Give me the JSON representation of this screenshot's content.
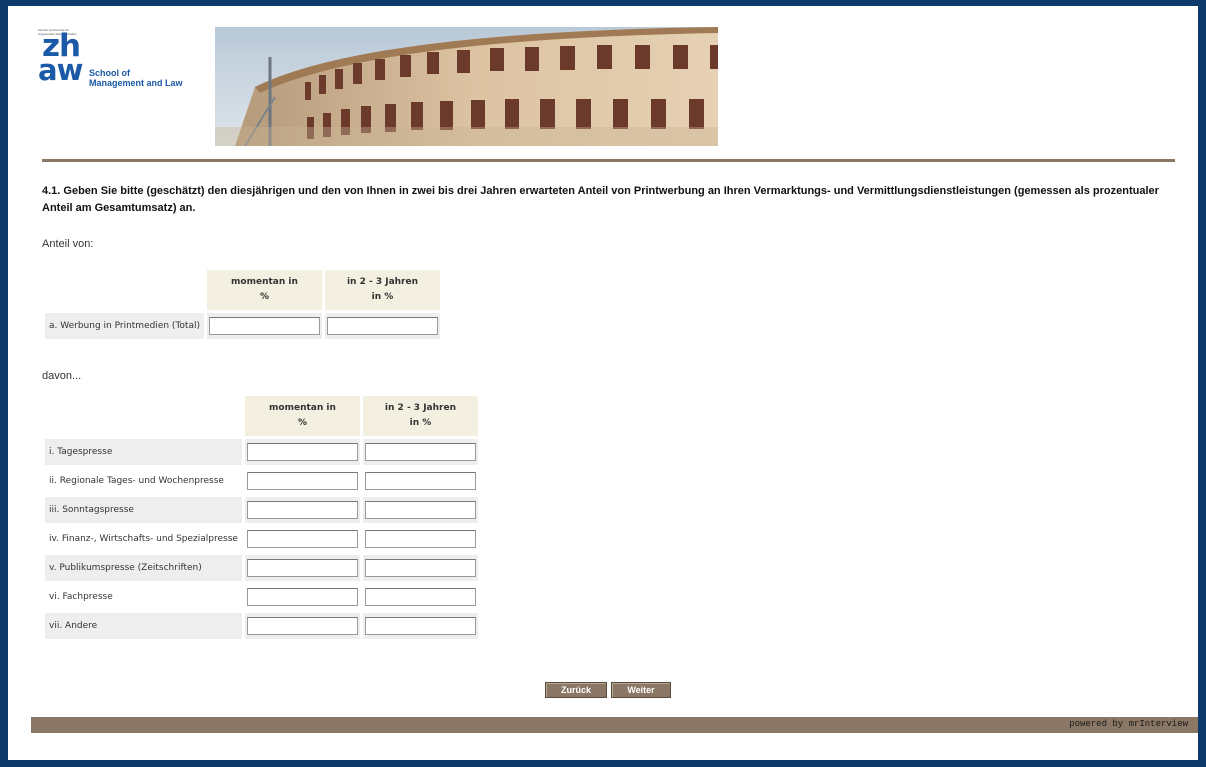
{
  "logo": {
    "tiny_text": "Zürcher Hochschule für Angewandte Wissenschaften",
    "zh": "zh",
    "aw": "aw",
    "school_line1": "School of",
    "school_line2": "Management and Law"
  },
  "question": {
    "text": "4.1. Geben Sie bitte (geschätzt) den diesjährigen und den von Ihnen in zwei bis drei Jahren erwarteten Anteil von Printwerbung an Ihren Vermarktungs- und Vermittlungsdienstleistungen (gemessen als prozentualer Anteil am Gesamtumsatz) an."
  },
  "section1": {
    "intro": "Anteil von:",
    "col1_line1": "momentan in",
    "col1_line2": "%",
    "col2_line1": "in 2 - 3 Jahren",
    "col2_line2": "in %",
    "rows": [
      {
        "label": "a. Werbung in Printmedien (Total)",
        "now": "",
        "future": ""
      }
    ]
  },
  "section2": {
    "intro": "davon...",
    "col1_line1": "momentan in",
    "col1_line2": "%",
    "col2_line1": "in 2 - 3 Jahren",
    "col2_line2": "in %",
    "rows": [
      {
        "label": "i. Tagespresse",
        "now": "",
        "future": ""
      },
      {
        "label": "ii. Regionale Tages- und Wochenpresse",
        "now": "",
        "future": ""
      },
      {
        "label": "iii. Sonntagspresse",
        "now": "",
        "future": ""
      },
      {
        "label": "iv. Finanz-, Wirtschafts- und Spezialpresse",
        "now": "",
        "future": ""
      },
      {
        "label": "v. Publikumspresse (Zeitschriften)",
        "now": "",
        "future": ""
      },
      {
        "label": "vi. Fachpresse",
        "now": "",
        "future": ""
      },
      {
        "label": "vii. Andere",
        "now": "",
        "future": ""
      }
    ]
  },
  "nav": {
    "back_label": "Zurück",
    "next_label": "Weiter"
  },
  "footer": {
    "powered": "powered by mrInterview"
  },
  "colors": {
    "page_border": "#0d3a6b",
    "accent_brown": "#8b7765",
    "logo_blue": "#1b5aa6",
    "header_cell": "#f3efe1",
    "row_shade": "#eeeeee"
  }
}
